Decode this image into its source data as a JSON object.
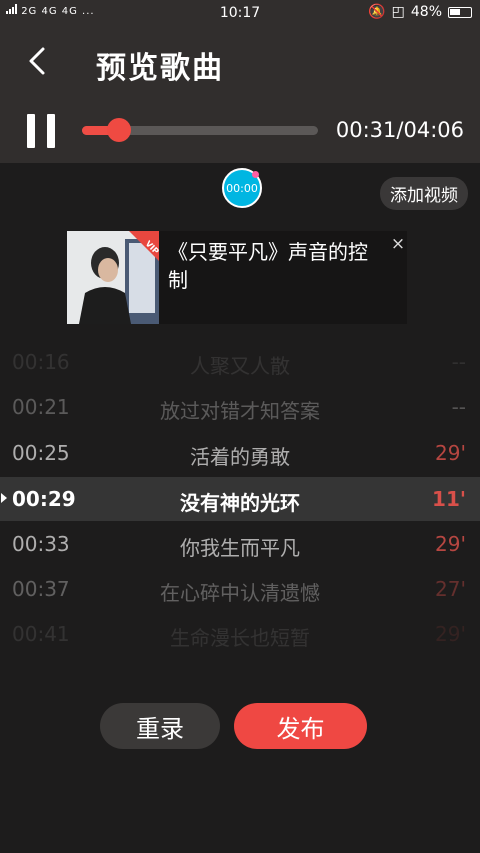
{
  "status_bar": {
    "network": "2G 4G 4G ...",
    "time": "10:17",
    "battery": "48%"
  },
  "header": {
    "title": "预览歌曲"
  },
  "player": {
    "progress_fraction": 0.155,
    "time_readout": "00:31/04:06"
  },
  "bubble": {
    "label": "00:00"
  },
  "add_video_label": "添加视频",
  "ad": {
    "badge": "VIP",
    "text": "《只要平凡》声音的控制",
    "close": "×"
  },
  "lyrics": [
    {
      "time": "00:16",
      "line": "人聚又人散",
      "score": "--",
      "opacity": 0.12
    },
    {
      "time": "00:21",
      "line": "放过对错才知答案",
      "score": "--",
      "opacity": 0.35
    },
    {
      "time": "00:25",
      "line": "活着的勇敢",
      "score": "29'",
      "opacity": 0.82
    },
    {
      "time": "00:29",
      "line": "没有神的光环",
      "score": "11'",
      "opacity": 1
    },
    {
      "time": "00:33",
      "line": "你我生而平凡",
      "score": "29'",
      "opacity": 0.82
    },
    {
      "time": "00:37",
      "line": "在心碎中认清遗憾",
      "score": "27'",
      "opacity": 0.38
    },
    {
      "time": "00:41",
      "line": "生命漫长也短暂",
      "score": "29'",
      "opacity": 0.12
    }
  ],
  "actions": {
    "rerecord_label": "重录",
    "publish_label": "发布"
  },
  "colors": {
    "accent": "#ef4843",
    "header_bg": "#312e2d",
    "page_bg": "#1d1c1c"
  }
}
